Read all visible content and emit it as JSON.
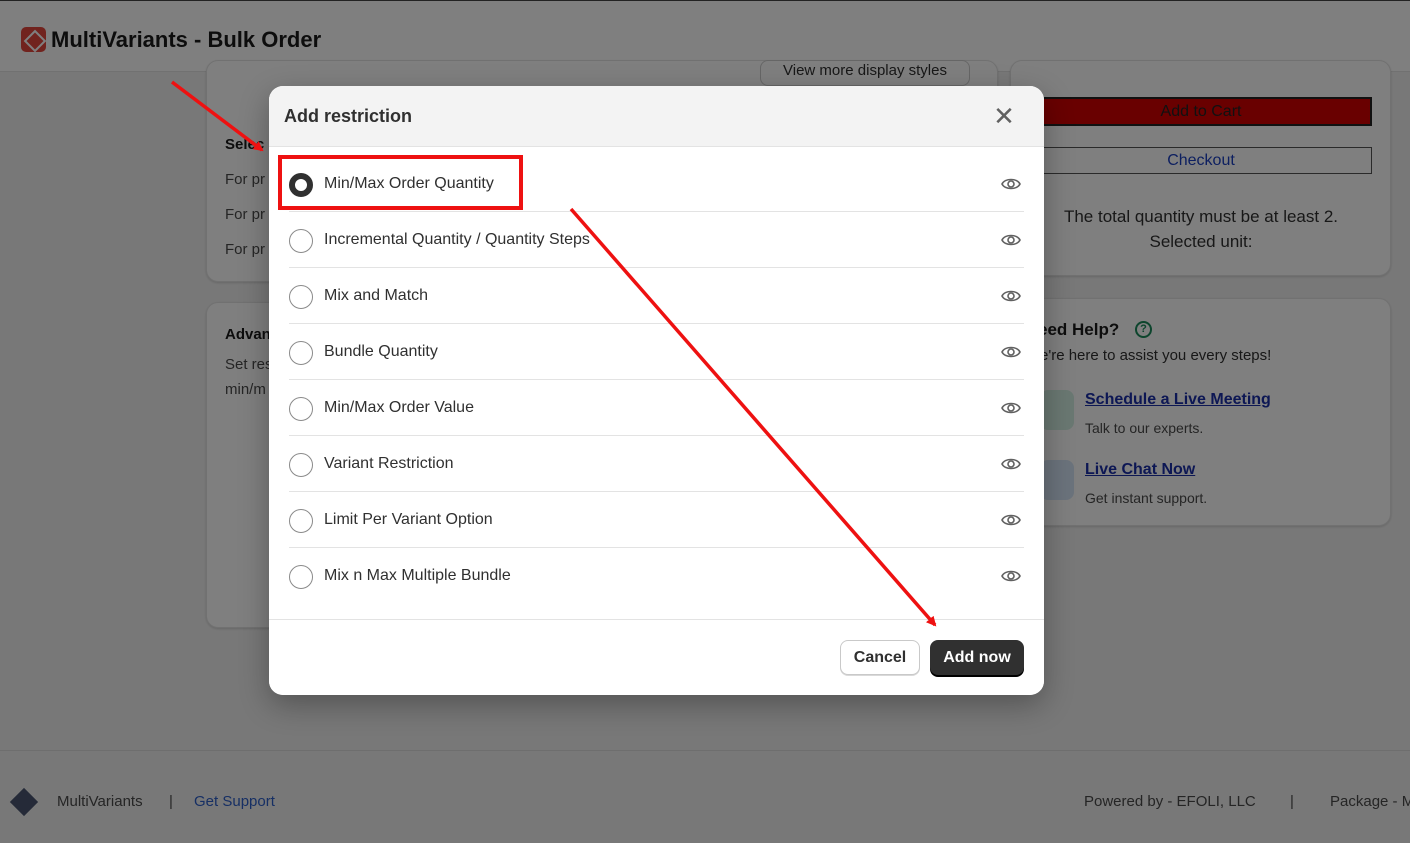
{
  "app": {
    "title": "MultiVariants - Bulk Order"
  },
  "background": {
    "view_more_styles": "View more display styles",
    "card_a": {
      "heading": "Selec",
      "lines": [
        "For pr",
        "For pr",
        "For pr"
      ]
    },
    "card_b": {
      "heading": "Advan",
      "lines": [
        "Set res",
        "min/m"
      ]
    },
    "preview": {
      "add_to_cart": "Add to Cart",
      "checkout": "Checkout",
      "total_msg_1": "The total quantity must be at least 2.",
      "total_msg_2": "Selected unit:"
    },
    "help": {
      "title": "eed Help?",
      "subtitle": "e're here to assist you every steps!",
      "schedule_link": "Schedule a Live Meeting",
      "schedule_desc": "Talk to our experts.",
      "chat_link": "Live Chat Now",
      "chat_desc": "Get instant support."
    }
  },
  "modal": {
    "title": "Add restriction",
    "options": [
      {
        "label": "Min/Max Order Quantity",
        "checked": true
      },
      {
        "label": "Incremental Quantity / Quantity Steps",
        "checked": false
      },
      {
        "label": "Mix and Match",
        "checked": false
      },
      {
        "label": "Bundle Quantity",
        "checked": false
      },
      {
        "label": "Min/Max Order Value",
        "checked": false
      },
      {
        "label": "Variant Restriction",
        "checked": false
      },
      {
        "label": "Limit Per Variant Option",
        "checked": false
      },
      {
        "label": "Mix n Max Multiple Bundle",
        "checked": false
      }
    ],
    "cancel_label": "Cancel",
    "add_label": "Add now"
  },
  "footer": {
    "brand": "MultiVariants",
    "separator": "|",
    "support_link": "Get Support",
    "powered_by": "Powered by - EFOLI, LLC",
    "package": "Package - M"
  },
  "colors": {
    "annotation": "#ee1111",
    "primary_button": "#303030",
    "link": "#2c5ec9"
  }
}
